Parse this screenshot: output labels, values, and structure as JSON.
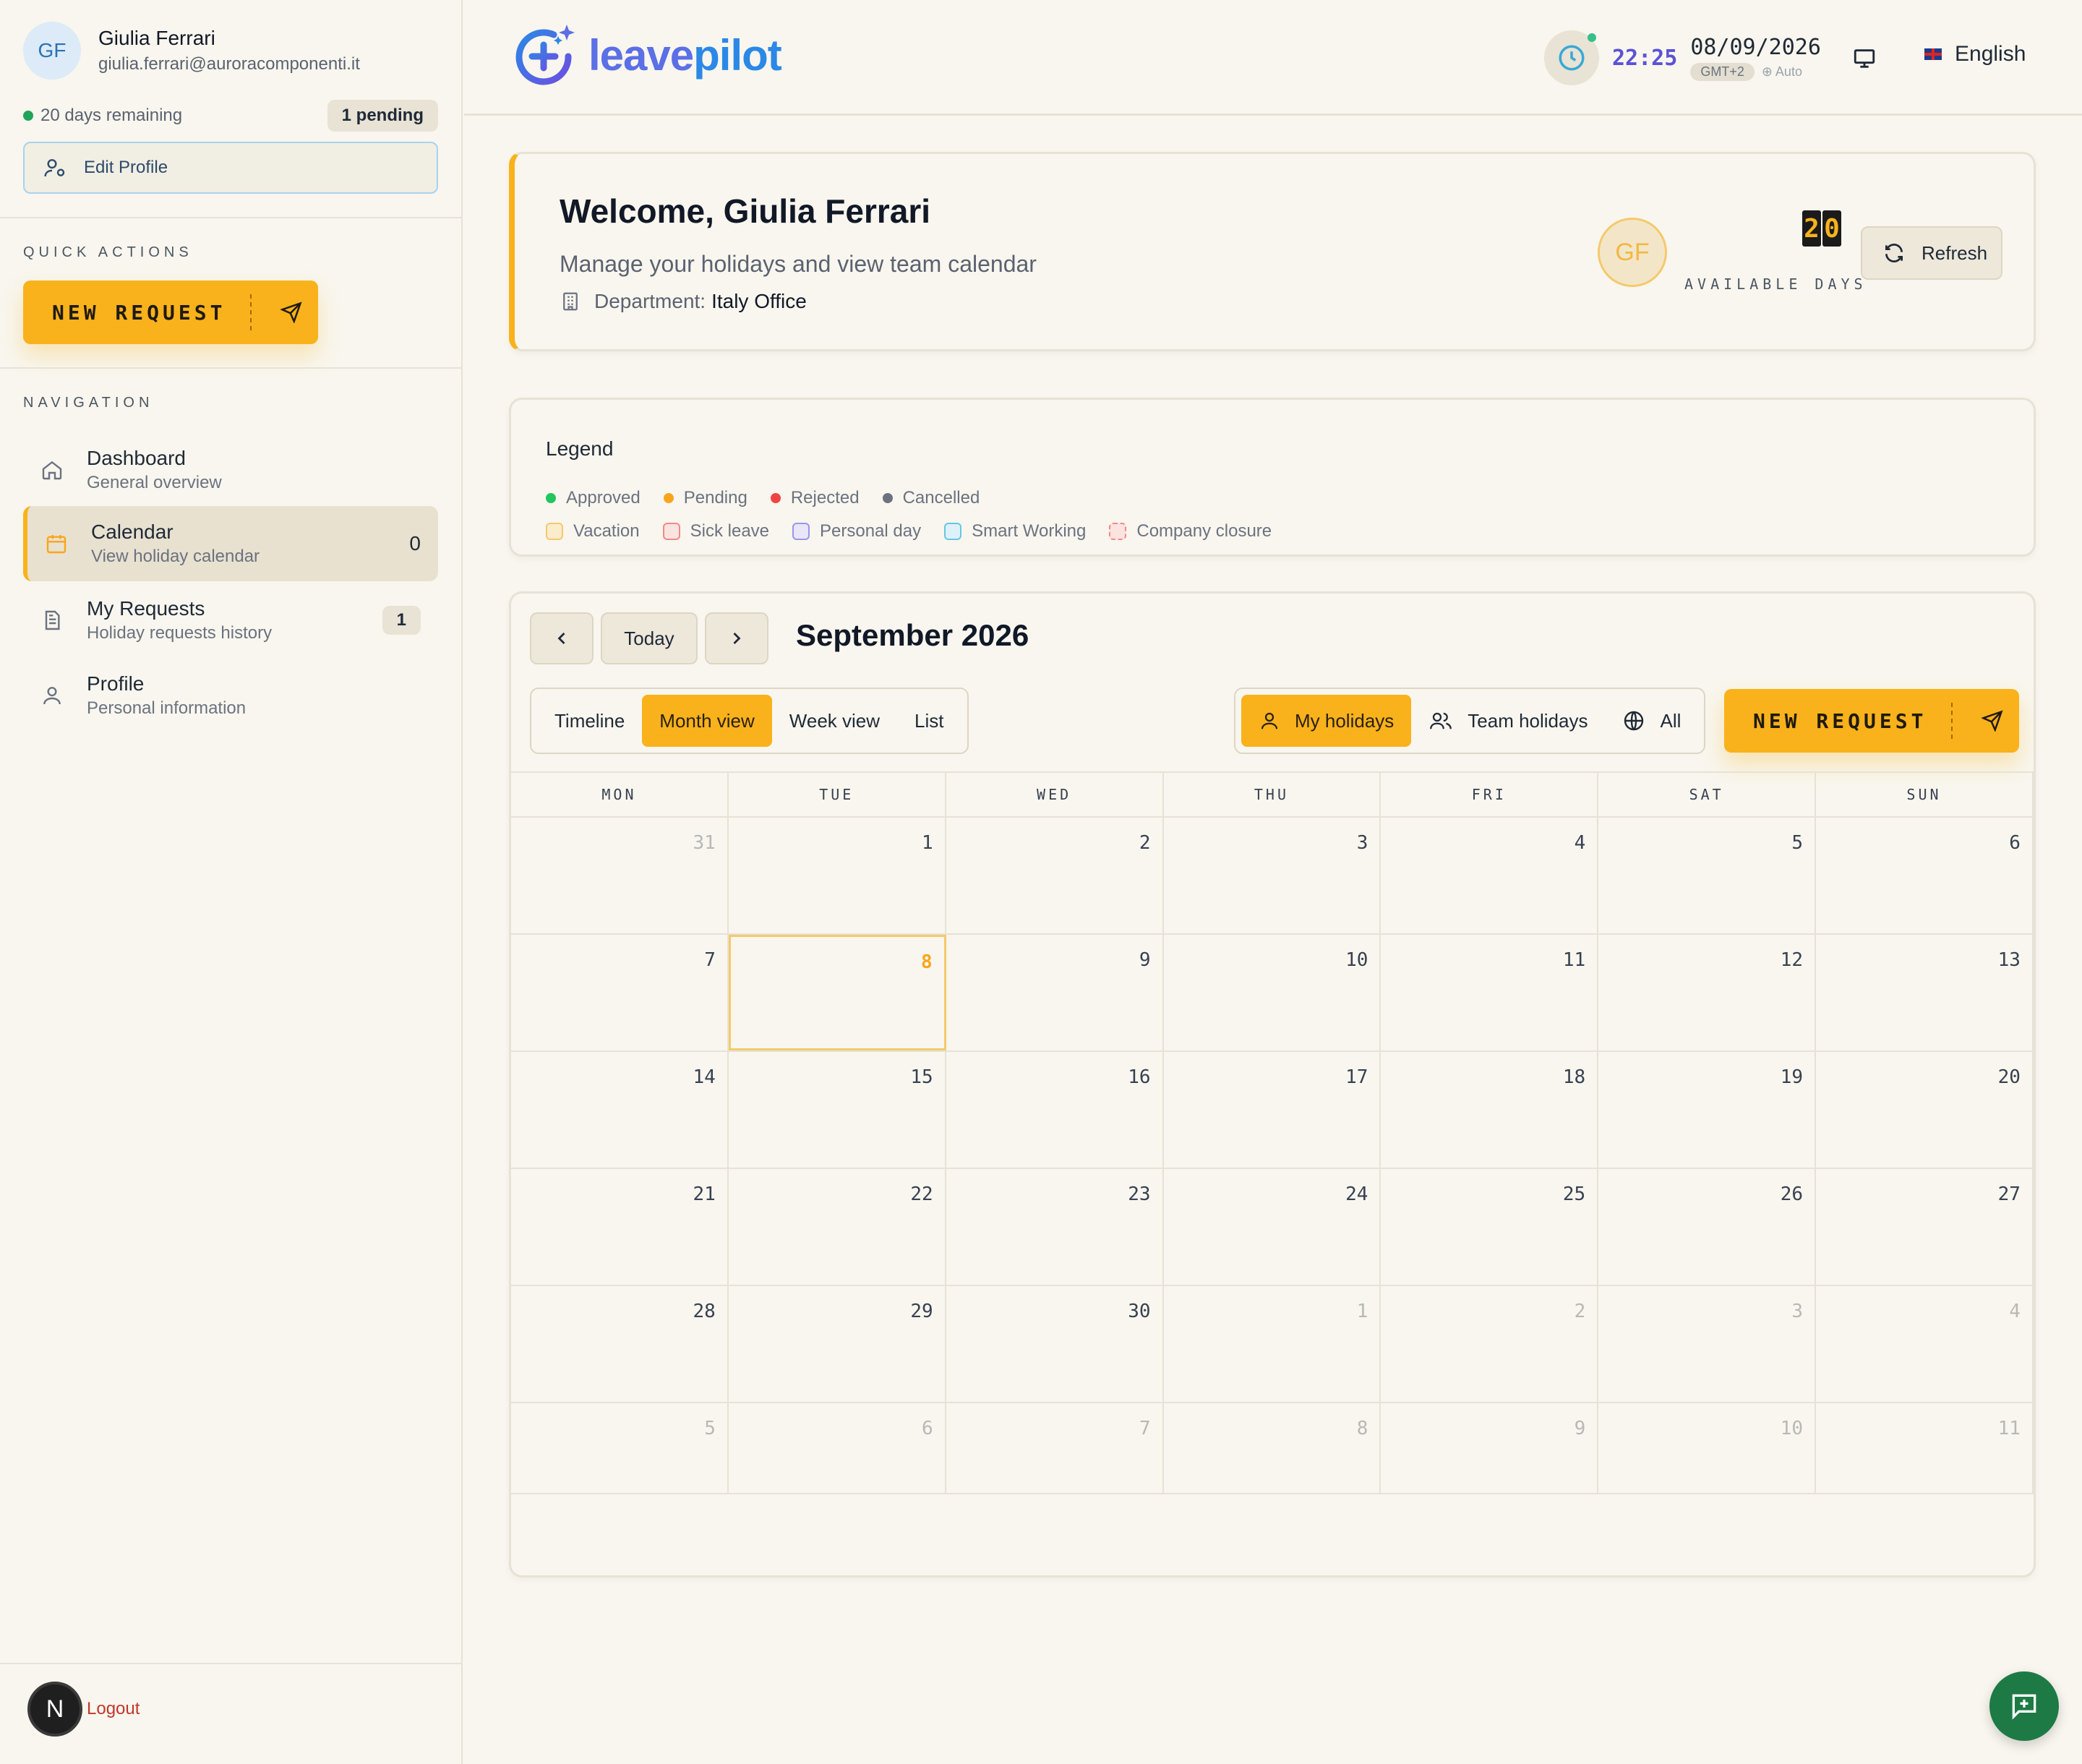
{
  "user": {
    "initials": "GF",
    "name": "Giulia Ferrari",
    "email": "giulia.ferrari@auroracomponenti.it",
    "days_remaining_text": "20 days remaining",
    "pending_badge": "1 pending",
    "edit_profile_label": "Edit Profile"
  },
  "sidebar": {
    "quick_actions_label": "QUICK ACTIONS",
    "new_request_label": "NEW REQUEST",
    "navigation_label": "NAVIGATION",
    "items": [
      {
        "title": "Dashboard",
        "subtitle": "General overview",
        "icon": "home-icon"
      },
      {
        "title": "Calendar",
        "subtitle": "View holiday calendar",
        "count": "0",
        "icon": "calendar-icon"
      },
      {
        "title": "My Requests",
        "subtitle": "Holiday requests history",
        "badge": "1",
        "icon": "document-icon"
      },
      {
        "title": "Profile",
        "subtitle": "Personal information",
        "icon": "user-icon"
      }
    ],
    "logout_avatar": "N",
    "logout_label": "Logout"
  },
  "header": {
    "brand_a": "leave",
    "brand_b": "pilot",
    "time": "22:25",
    "date": "08/09/2026",
    "timezone": "GMT+2",
    "tz_mode": "Auto",
    "language": "English"
  },
  "welcome": {
    "title": "Welcome, Giulia Ferrari",
    "subtitle": "Manage your holidays and view team calendar",
    "department_label": "Department:",
    "department_value": "Italy Office",
    "avatar_initials": "GF",
    "available_digit_1": "2",
    "available_digit_2": "0",
    "available_label": "AVAILABLE DAYS",
    "refresh_label": "Refresh"
  },
  "legend": {
    "title": "Legend",
    "statuses": [
      {
        "label": "Approved",
        "color": "#22c55e"
      },
      {
        "label": "Pending",
        "color": "#f9a51c"
      },
      {
        "label": "Rejected",
        "color": "#ef4444"
      },
      {
        "label": "Cancelled",
        "color": "#6b7280"
      }
    ],
    "types": [
      {
        "label": "Vacation",
        "color": "#f5c96b",
        "fill": "#fbeccb"
      },
      {
        "label": "Sick leave",
        "color": "#f08a8a",
        "fill": "#fbe3e0"
      },
      {
        "label": "Personal day",
        "color": "#9b97e8",
        "fill": "#e8e6f8"
      },
      {
        "label": "Smart Working",
        "color": "#66c6e6",
        "fill": "#ddf2f8"
      },
      {
        "label": "Company closure",
        "color": "#f08a8a",
        "fill": "#fbe3e0"
      }
    ]
  },
  "calendar": {
    "today_label": "Today",
    "month_title": "September 2026",
    "views": [
      "Timeline",
      "Month view",
      "Week view",
      "List"
    ],
    "active_view": "Month view",
    "scopes": [
      "My holidays",
      "Team holidays",
      "All"
    ],
    "active_scope": "My holidays",
    "new_request_label": "NEW REQUEST",
    "weekdays": [
      "MON",
      "TUE",
      "WED",
      "THU",
      "FRI",
      "SAT",
      "SUN"
    ],
    "weeks": [
      [
        {
          "d": "31",
          "o": true
        },
        {
          "d": "1"
        },
        {
          "d": "2"
        },
        {
          "d": "3"
        },
        {
          "d": "4"
        },
        {
          "d": "5"
        },
        {
          "d": "6"
        }
      ],
      [
        {
          "d": "7"
        },
        {
          "d": "8",
          "t": true
        },
        {
          "d": "9"
        },
        {
          "d": "10"
        },
        {
          "d": "11"
        },
        {
          "d": "12"
        },
        {
          "d": "13"
        }
      ],
      [
        {
          "d": "14"
        },
        {
          "d": "15"
        },
        {
          "d": "16"
        },
        {
          "d": "17"
        },
        {
          "d": "18"
        },
        {
          "d": "19"
        },
        {
          "d": "20"
        }
      ],
      [
        {
          "d": "21"
        },
        {
          "d": "22"
        },
        {
          "d": "23"
        },
        {
          "d": "24"
        },
        {
          "d": "25"
        },
        {
          "d": "26"
        },
        {
          "d": "27"
        }
      ],
      [
        {
          "d": "28"
        },
        {
          "d": "29"
        },
        {
          "d": "30"
        },
        {
          "d": "1",
          "o": true
        },
        {
          "d": "2",
          "o": true
        },
        {
          "d": "3",
          "o": true
        },
        {
          "d": "4",
          "o": true
        }
      ],
      [
        {
          "d": "5",
          "o": true
        },
        {
          "d": "6",
          "o": true
        },
        {
          "d": "7",
          "o": true
        },
        {
          "d": "8",
          "o": true
        },
        {
          "d": "9",
          "o": true
        },
        {
          "d": "10",
          "o": true
        },
        {
          "d": "11",
          "o": true
        }
      ]
    ]
  }
}
